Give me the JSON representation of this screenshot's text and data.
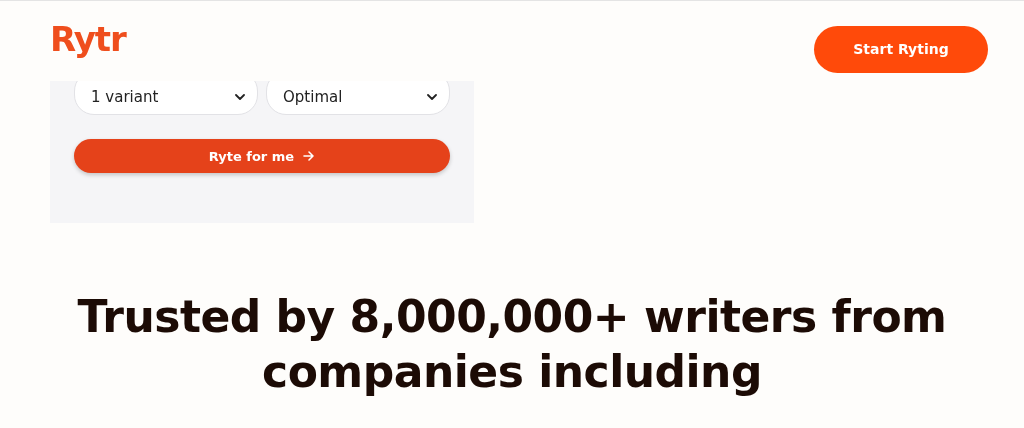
{
  "header": {
    "logo": "Rytr",
    "cta_button": "Start Ryting"
  },
  "form_panel": {
    "selects": [
      {
        "value": "1 variant"
      },
      {
        "value": "Optimal"
      }
    ],
    "submit_button": "Ryte for me"
  },
  "headline": "Trusted by 8,000,000+ writers from companies including"
}
